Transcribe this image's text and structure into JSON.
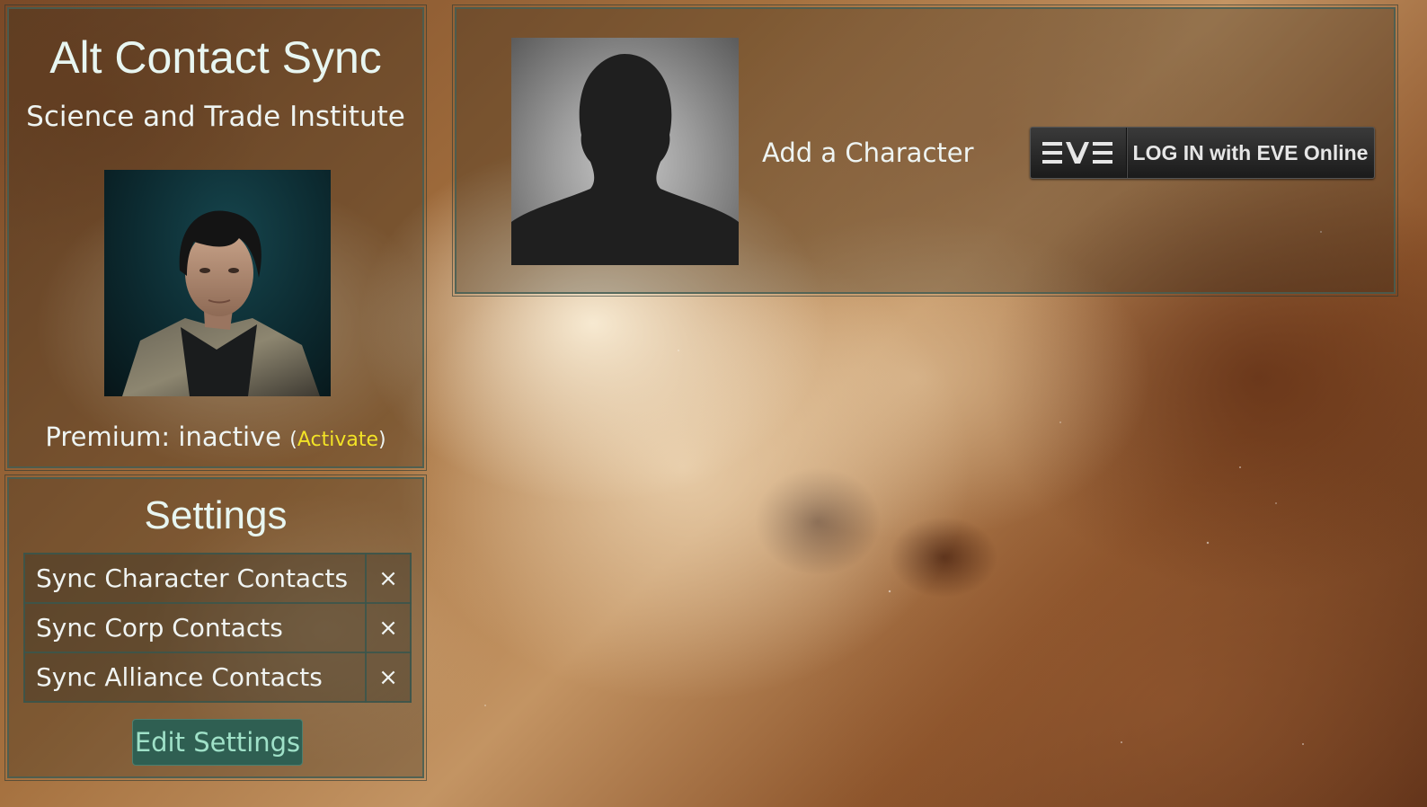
{
  "app": {
    "title": "Alt Contact Sync"
  },
  "profile": {
    "corporation": "Science and Trade Institute",
    "premium_label": "Premium: inactive",
    "paren_open": "(",
    "activate_link": "Activate",
    "paren_close": ")"
  },
  "settings": {
    "title": "Settings",
    "rows": [
      {
        "label": "Sync Character Contacts",
        "state": "×"
      },
      {
        "label": "Sync Corp Contacts",
        "state": "×"
      },
      {
        "label": "Sync Alliance Contacts",
        "state": "×"
      }
    ],
    "edit_button": "Edit Settings"
  },
  "add_character": {
    "label": "Add a Character",
    "login_button": {
      "logo_text": "EVE",
      "text": "LOG IN with EVE Online"
    }
  },
  "colors": {
    "accent_link": "#f2e326",
    "button_bg": "#2f5f52",
    "button_text": "#9fe1c8",
    "panel_border": "#465f55"
  }
}
